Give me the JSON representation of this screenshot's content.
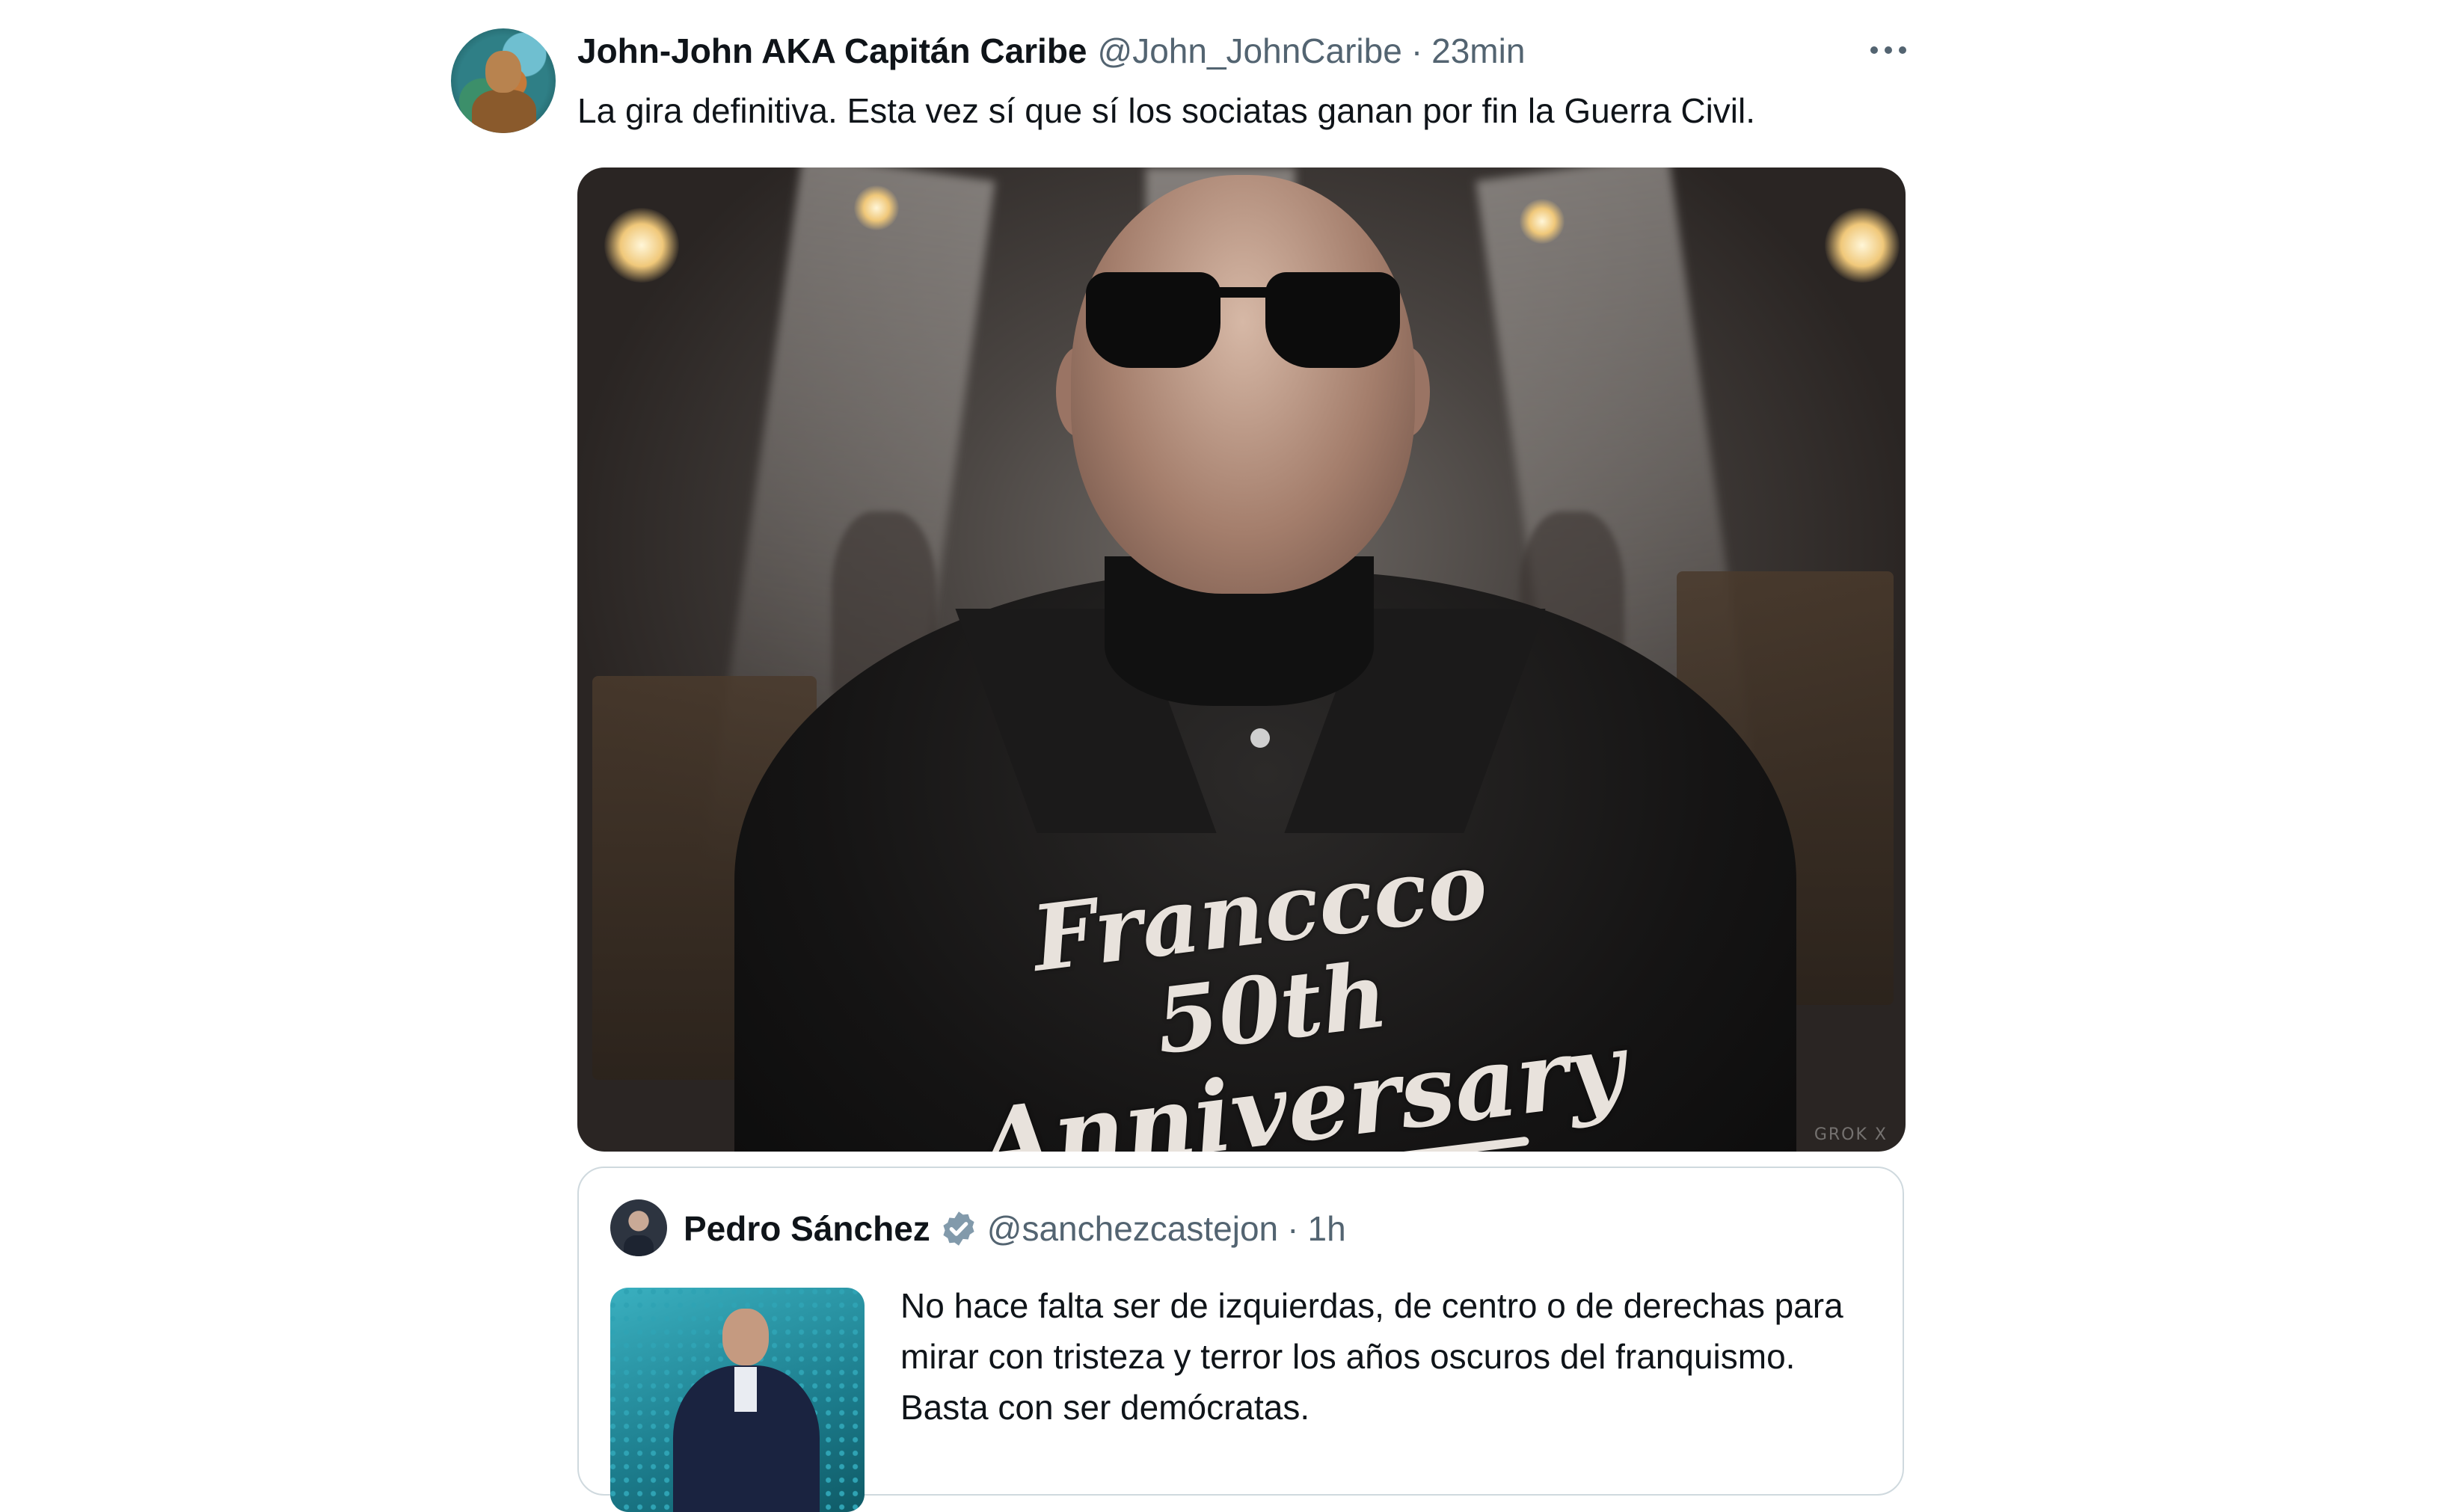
{
  "tweet": {
    "author": {
      "display_name": "John-John AKA Capitán Caribe",
      "handle": "@John_JohnCaribe",
      "avatar_icon": "user-avatar"
    },
    "separator": "·",
    "time": "23min",
    "more_icon": "more-horizontal-icon",
    "text": "La gira definitiva. Esta vez sí que sí los sociatas ganan por fin la Guerra Civil.",
    "media": {
      "logo_line1": "Franccco 50th",
      "logo_line2": "Anniversary",
      "watermark": "GROK X"
    }
  },
  "quoted_tweet": {
    "author": {
      "display_name": "Pedro Sánchez",
      "handle": "@sanchezcastejon",
      "verified_icon": "verified-badge-icon"
    },
    "separator": "·",
    "time": "1h",
    "text": "No hace falta ser de izquierdas, de centro o de derechas para mirar con tristeza y terror los años oscuros del franquismo. Basta con ser demócratas."
  },
  "colors": {
    "text_primary": "#0f1419",
    "text_secondary": "#536471",
    "border": "#cfd9de",
    "verified_badge": "#829aab"
  }
}
